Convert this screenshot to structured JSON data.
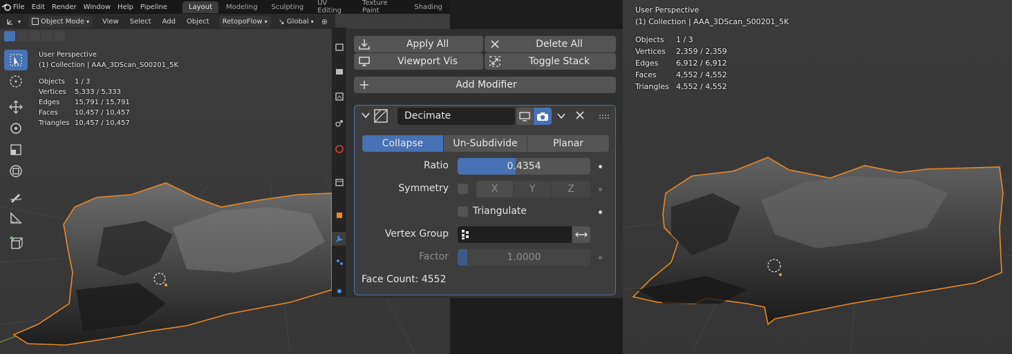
{
  "topbar": {
    "menus": [
      "File",
      "Edit",
      "Render",
      "Window",
      "Help",
      "Pipeline"
    ],
    "workspaces": [
      "Layout",
      "Modeling",
      "Sculpting",
      "UV Editing",
      "Texture Paint",
      "Shading"
    ]
  },
  "header": {
    "mode": "Object Mode",
    "menus": [
      "View",
      "Select",
      "Add",
      "Object"
    ],
    "addon": "RetopoFlow",
    "orientation": "Global"
  },
  "left_stats": {
    "view": "User Perspective",
    "collection": "(1) Collection | AAA_3DScan_S00201_5K",
    "rows": [
      {
        "k": "Objects",
        "v": "1 / 3"
      },
      {
        "k": "Vertices",
        "v": "5,333 / 5,333"
      },
      {
        "k": "Edges",
        "v": "15,791 / 15,791"
      },
      {
        "k": "Faces",
        "v": "10,457 / 10,457"
      },
      {
        "k": "Triangles",
        "v": "10,457 / 10,457"
      }
    ]
  },
  "right_stats": {
    "view": "User Perspective",
    "collection": "(1) Collection | AAA_3DScan_S00201_5K",
    "rows": [
      {
        "k": "Objects",
        "v": "1 / 3"
      },
      {
        "k": "Vertices",
        "v": "2,359 / 2,359"
      },
      {
        "k": "Edges",
        "v": "6,912 / 6,912"
      },
      {
        "k": "Faces",
        "v": "4,552 / 4,552"
      },
      {
        "k": "Triangles",
        "v": "4,552 / 4,552"
      }
    ]
  },
  "panel": {
    "apply_all": "Apply All",
    "delete_all": "Delete All",
    "viewport_vis": "Viewport Vis",
    "toggle_stack": "Toggle Stack",
    "add_modifier": "Add Modifier",
    "modifier_name": "Decimate",
    "tabs": [
      "Collapse",
      "Un-Subdivide",
      "Planar"
    ],
    "active_tab": "Collapse",
    "ratio_label": "Ratio",
    "ratio_value": "0.4354",
    "ratio_fraction": 0.4354,
    "symmetry_label": "Symmetry",
    "axes": [
      "X",
      "Y",
      "Z"
    ],
    "triangulate_label": "Triangulate",
    "vertex_group_label": "Vertex Group",
    "factor_label": "Factor",
    "factor_value": "1.0000",
    "face_count": "Face Count: 4552"
  },
  "colors": {
    "accent": "#4772b3",
    "selection_outline": "#e8892a"
  }
}
